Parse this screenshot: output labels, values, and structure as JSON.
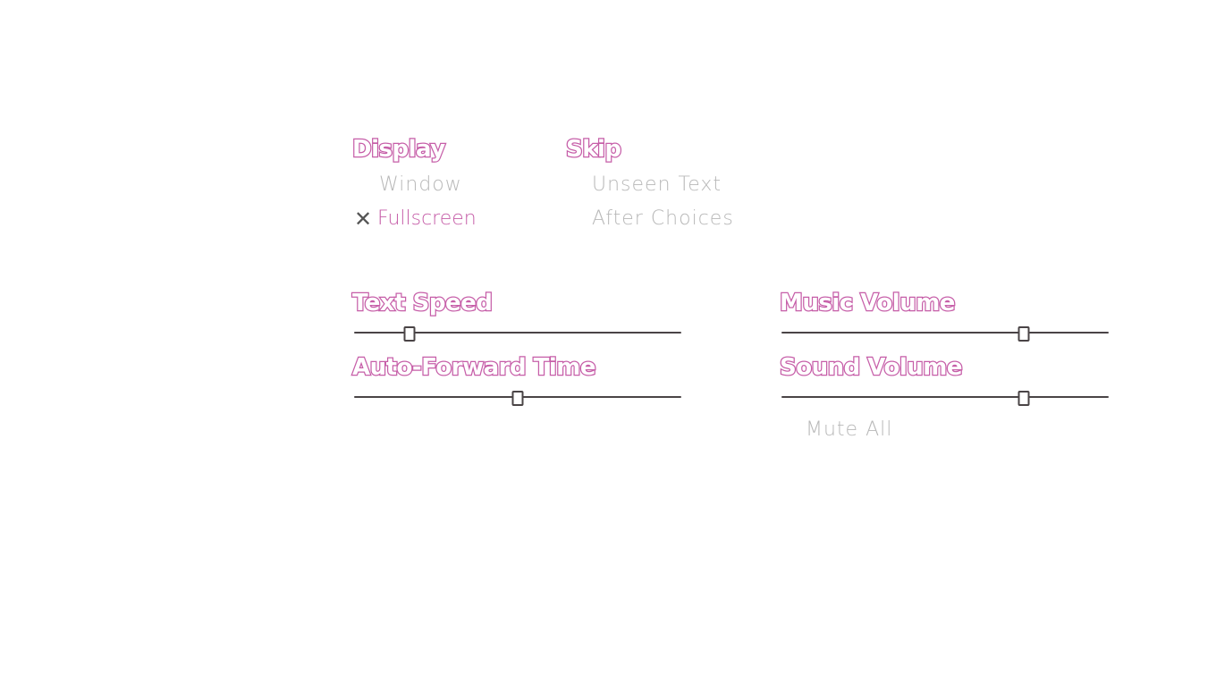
{
  "display": {
    "title": "Display",
    "options": [
      {
        "label": "Window",
        "selected": false
      },
      {
        "label": "Fullscreen",
        "selected": true
      }
    ],
    "check_icon": "x-mark-icon"
  },
  "skip": {
    "title": "Skip",
    "options": [
      {
        "label": "Unseen Text",
        "selected": false
      },
      {
        "label": "After Choices",
        "selected": false
      }
    ]
  },
  "sliders": {
    "text_speed": {
      "label": "Text Speed",
      "value": 0.17
    },
    "auto_forward_time": {
      "label": "Auto-Forward Time",
      "value": 0.5
    },
    "music_volume": {
      "label": "Music Volume",
      "value": 0.74
    },
    "sound_volume": {
      "label": "Sound Volume",
      "value": 0.74
    }
  },
  "mute_all": {
    "label": "Mute All",
    "selected": false
  },
  "colors": {
    "accent": "#c65ea8",
    "inactive_text": "#b8b8b8",
    "track": "#4a4446",
    "background": "#ffffff"
  }
}
